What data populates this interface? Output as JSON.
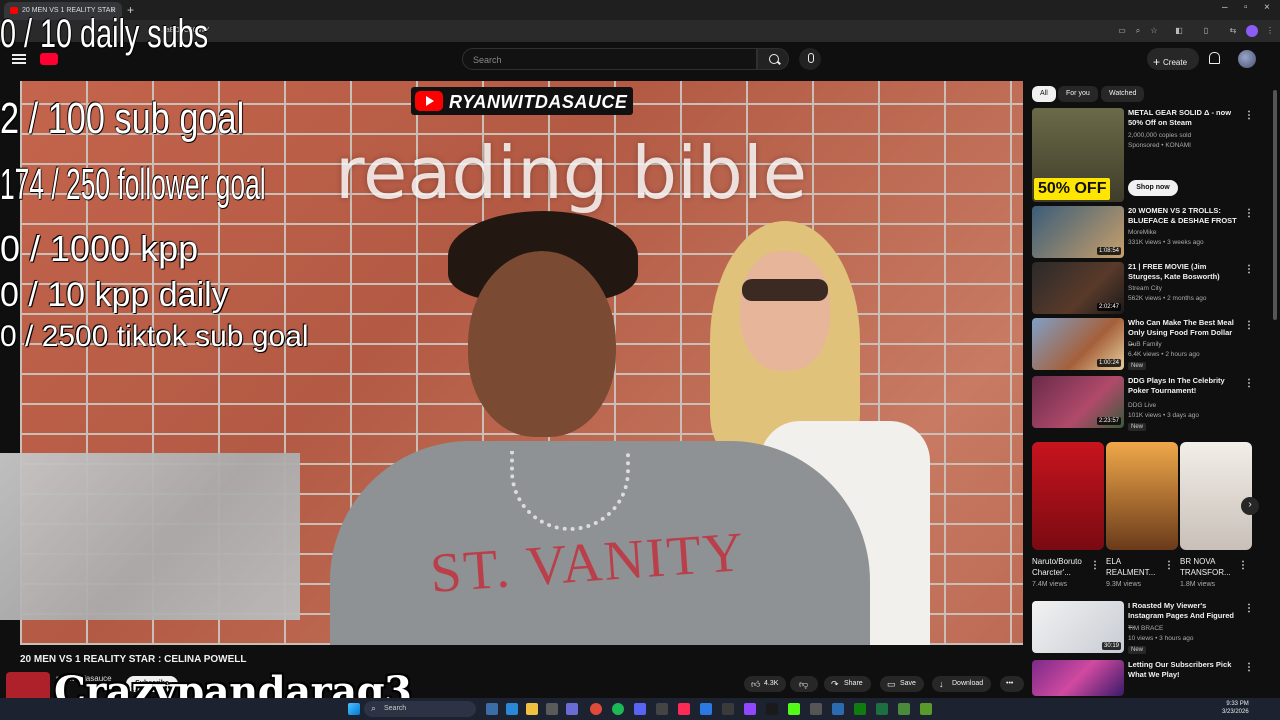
{
  "browser": {
    "tab_title": "20 MEN VS 1 REALITY STAR",
    "url": "...aEOhC5QWY"
  },
  "masthead": {
    "search_placeholder": "Search",
    "create_label": "Create"
  },
  "video": {
    "brand_text": "RYANWITDASAUCE",
    "caption": "reading bible",
    "shirt_text": "ST. VANITY",
    "title": "20 MEN VS 1 REALITY STAR : CELINA POWELL",
    "channel": "ryanwitdasauce",
    "subscribe_label": "Subscribe",
    "likes": "4.3K",
    "share_label": "Share",
    "save_label": "Save",
    "download_label": "Download"
  },
  "overlays": {
    "daily_subs": "0 / 10 daily subs",
    "sub_goal": "2  / 100 sub goal",
    "follower_goal": "174 / 250 follower goal",
    "kpp": "0 / 1000 kpp",
    "kpp_daily": "0 / 10 kpp daily",
    "tiktok_goal": "0 / 2500 tiktok sub goal",
    "watermark": "Crazypandarag3"
  },
  "chips": [
    "All",
    "For you",
    "Watched"
  ],
  "recommendations": [
    {
      "title": "METAL GEAR SOLID Δ - now 50% Off on Steam",
      "channel": "2,000,000 copies sold",
      "meta": "Sponsored • KONAMI",
      "thumb_badge": "50% OFF",
      "cta": "Shop now",
      "thumb_color": "#5b5a3a"
    },
    {
      "title": "20 WOMEN VS 2 TROLLS: BLUEFACE & DESHAE FROST",
      "channel": "MoreMike",
      "meta": "331K views • 3 weeks ago",
      "duration": "1:08:54",
      "thumb_color": "#3a5c7a"
    },
    {
      "title": "21 | FREE MOVIE (Jim Sturgess, Kate Bosworth)",
      "channel": "Stream City",
      "meta": "562K views • 2 months ago",
      "duration": "2:02:47",
      "thumb_color": "#3b2f2a"
    },
    {
      "title": "Who Can Make The Best Meal Only Using Food From Dollar ...",
      "channel": "DuB Family",
      "meta": "6.4K views • 2 hours ago",
      "badge": "New",
      "duration": "1:00:24",
      "thumb_color": "#a5603a"
    },
    {
      "title": "DDG Plays In The Celebrity Poker Tournament!",
      "channel": "DDG Live",
      "meta": "101K views • 3 days ago",
      "badge": "New",
      "duration": "2:23:57",
      "thumb_color": "#6a2b4a"
    },
    {
      "title": "I Roasted My Viewer's Instagram Pages And Figured ...",
      "channel": "TIM BRACE",
      "meta": "10 views • 3 hours ago",
      "badge": "New",
      "duration": "30:19",
      "thumb_color": "#d9dbe0"
    },
    {
      "title": "Letting Our Subscribers Pick What We Play!",
      "channel": "",
      "meta": "",
      "thumb_color": "#7a2a8a"
    }
  ],
  "shorts": [
    {
      "title": "Naruto/Boruto Charcter'...",
      "views": "7.4M views",
      "color": "#b4141e"
    },
    {
      "title": "ELA REALMENT...",
      "views": "9.3M views",
      "color": "#c37a2e"
    },
    {
      "title": "BR NOVA TRANSFOR...",
      "views": "1.8M views",
      "color": "#e6e0da"
    }
  ],
  "taskbar": {
    "search_label": "Search",
    "time": "9:33 PM",
    "date": "3/23/2026"
  },
  "colors": {
    "background": "#0f0f0f",
    "accent_red": "#ff0000",
    "chip_active": "#f1f1f1"
  }
}
